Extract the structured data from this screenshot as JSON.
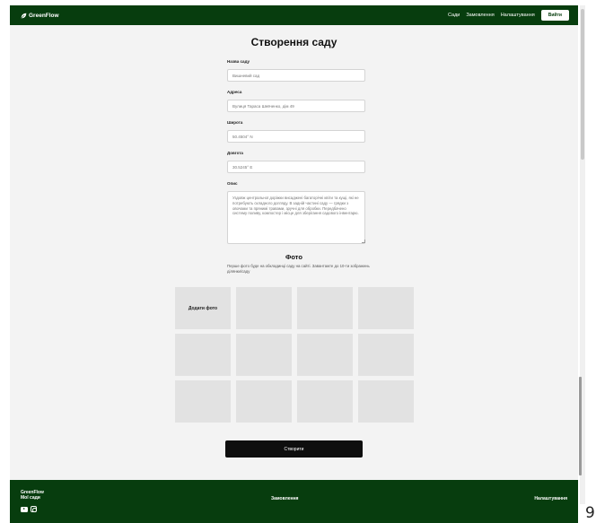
{
  "header": {
    "logo_text": "GreenFlow",
    "nav": [
      {
        "label": "Сади"
      },
      {
        "label": "Замовлення"
      },
      {
        "label": "Налаштування"
      }
    ],
    "logout_label": "Вийти"
  },
  "form": {
    "title": "Створення саду",
    "name_label": "Назва саду",
    "name_placeholder": "Вишневий сад",
    "address_label": "Адреса",
    "address_placeholder": "Вулиця Тараса Шевченко, дім 49",
    "lat_label": "Широта",
    "lat_placeholder": "50.4504° N",
    "lng_label": "Довгота",
    "lng_placeholder": "30.5245° E",
    "desc_label": "Опис",
    "desc_placeholder": "Уздовж центральної доріжки висаджені багаторічні квіти та кущі, які не потребують складного догляду. В задній частині саду — грядки з овочами та прянимі травами, зручні для обробки. Передбачено систему поливу, компостер і місце для зберігання садового інвентарю."
  },
  "photos": {
    "title": "Фото",
    "note": "Перше фото буде на обкладинці саду на сайті. Завантажте до 10-ти зображень ділянки/саду",
    "add_label": "Додати фото",
    "tile_count": 12
  },
  "submit_label": "Створити",
  "footer": {
    "brand_line1": "GreenFlow",
    "brand_line2": "Мої сади",
    "orders": "Замовлення",
    "settings": "Налаштування"
  },
  "icons": {
    "logo": "leaf-icon",
    "social": [
      "youtube-icon",
      "instagram-icon"
    ]
  },
  "colors": {
    "brand": "#073d0e",
    "background": "#f3f3f3",
    "button": "#0e0e0e"
  }
}
